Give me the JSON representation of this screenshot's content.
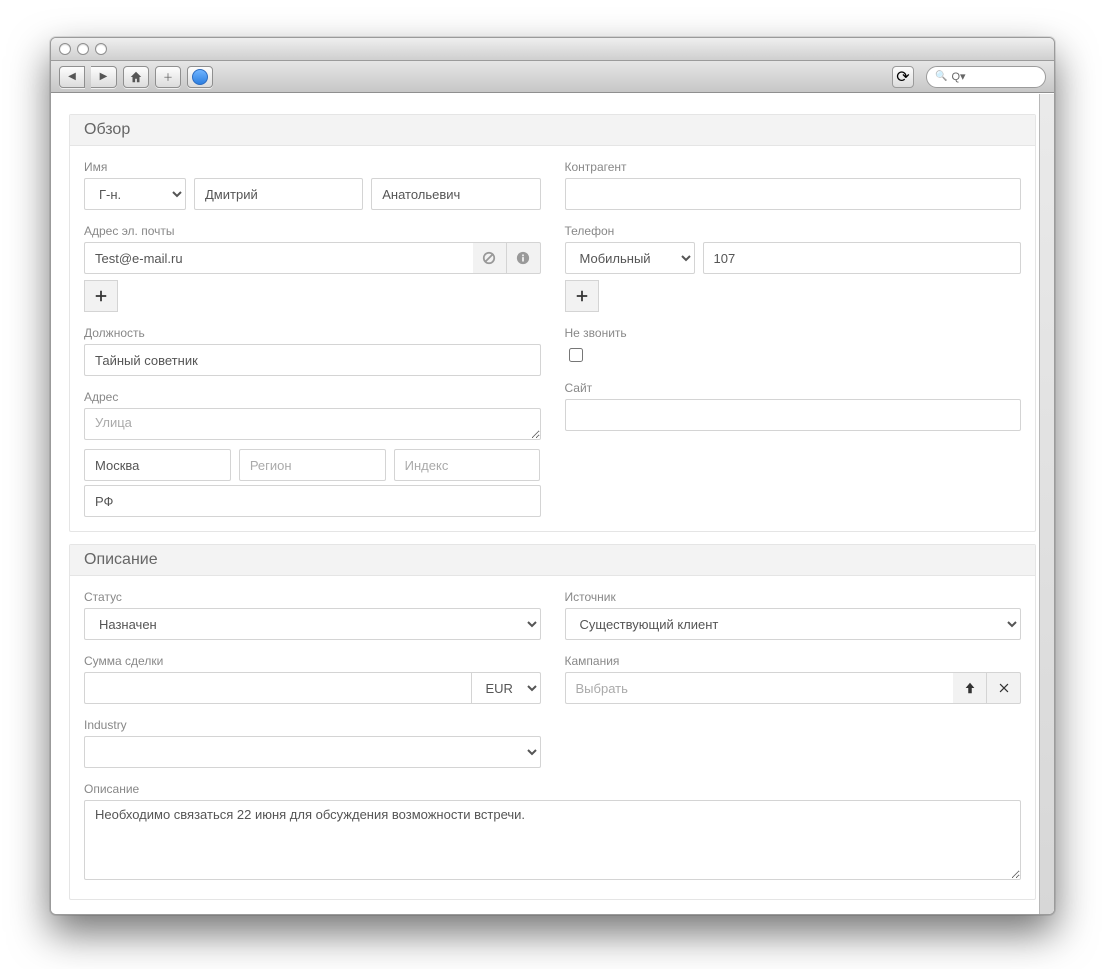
{
  "chrome": {
    "search_placeholder": "Q▾"
  },
  "panels": {
    "overview": {
      "title": "Обзор"
    },
    "description": {
      "title": "Описание"
    }
  },
  "overview": {
    "name": {
      "label": "Имя",
      "salutation": "Г-н.",
      "first": "Дмитрий",
      "last": "Анатольевич"
    },
    "account": {
      "label": "Контрагент",
      "value": ""
    },
    "email": {
      "label": "Адрес эл. почты",
      "value": "Test@e-mail.ru"
    },
    "phone": {
      "label": "Телефон",
      "type": "Мобильный",
      "number": "107"
    },
    "position": {
      "label": "Должность",
      "value": "Тайный советник"
    },
    "doNotCall": {
      "label": "Не звонить",
      "checked": false
    },
    "address": {
      "label": "Адрес",
      "street_placeholder": "Улица",
      "city": "Москва",
      "region_placeholder": "Регион",
      "zip_placeholder": "Индекс",
      "country": "РФ"
    },
    "site": {
      "label": "Сайт",
      "value": ""
    }
  },
  "description": {
    "status": {
      "label": "Статус",
      "value": "Назначен"
    },
    "source": {
      "label": "Источник",
      "value": "Существующий клиент"
    },
    "amount": {
      "label": "Сумма сделки",
      "value": "",
      "currency": "EUR"
    },
    "campaign": {
      "label": "Кампания",
      "placeholder": "Выбрать"
    },
    "industry": {
      "label": "Industry",
      "value": ""
    },
    "desc": {
      "label": "Описание",
      "value": "Необходимо связаться 22 июня для обсуждения возможности встречи."
    }
  }
}
